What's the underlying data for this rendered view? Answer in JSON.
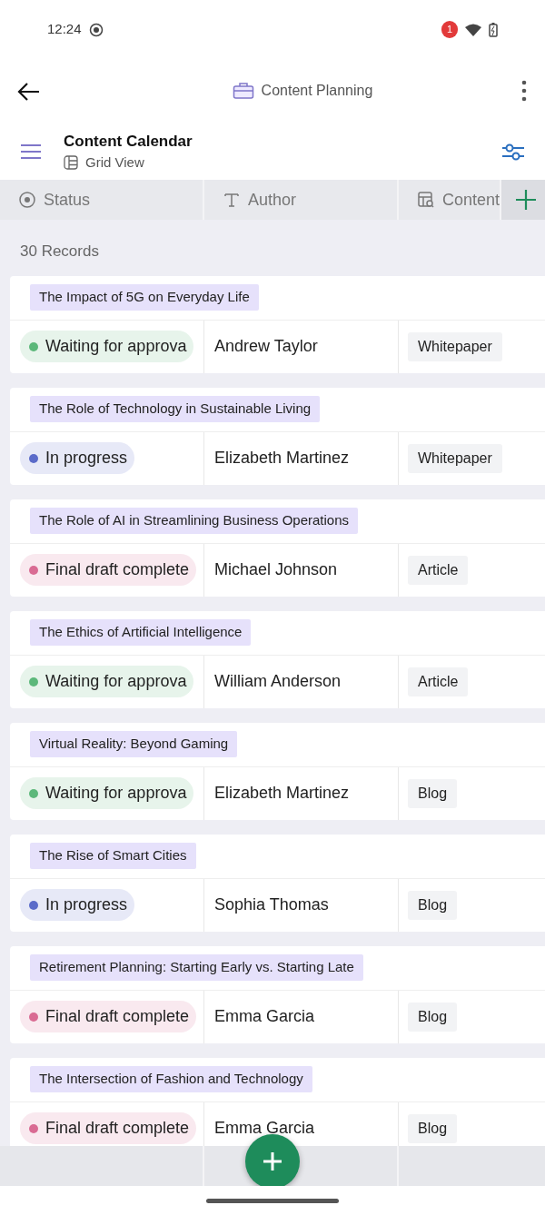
{
  "status_bar": {
    "time": "12:24",
    "notification_count": "1"
  },
  "app_bar": {
    "title": "Content Planning"
  },
  "header": {
    "title": "Content Calendar",
    "view": "Grid View"
  },
  "columns": [
    {
      "kind": "status",
      "label": "Status"
    },
    {
      "kind": "text",
      "label": "Author"
    },
    {
      "kind": "lookup",
      "label": "Content"
    }
  ],
  "record_count": "30 Records",
  "records": [
    {
      "title": "The Impact of 5G on Everyday Life",
      "status": "Waiting for approva",
      "color": "#5cb87a",
      "author": "Andrew Taylor",
      "content": "Whitepaper"
    },
    {
      "title": "The Role of Technology in Sustainable Living",
      "status": "In progress",
      "color": "#5b6bc9",
      "author": "Elizabeth Martinez",
      "content": "Whitepaper"
    },
    {
      "title": "The Role of AI in Streamlining Business Operations",
      "status": "Final draft complete",
      "color": "#d96b93",
      "author": "Michael Johnson",
      "content": "Article"
    },
    {
      "title": "The Ethics of Artificial Intelligence",
      "status": "Waiting for approva",
      "color": "#5cb87a",
      "author": "William Anderson",
      "content": "Article"
    },
    {
      "title": "Virtual Reality: Beyond Gaming",
      "status": "Waiting for approva",
      "color": "#5cb87a",
      "author": "Elizabeth Martinez",
      "content": "Blog"
    },
    {
      "title": "The Rise of Smart Cities",
      "status": "In progress",
      "color": "#5b6bc9",
      "author": "Sophia Thomas",
      "content": "Blog"
    },
    {
      "title": "Retirement Planning: Starting Early vs. Starting Late",
      "status": "Final draft complete",
      "color": "#d96b93",
      "author": "Emma Garcia",
      "content": "Blog"
    },
    {
      "title": "The Intersection of Fashion and Technology",
      "status": "Final draft complete",
      "color": "#d96b93",
      "author": "Emma Garcia",
      "content": "Blog"
    }
  ]
}
